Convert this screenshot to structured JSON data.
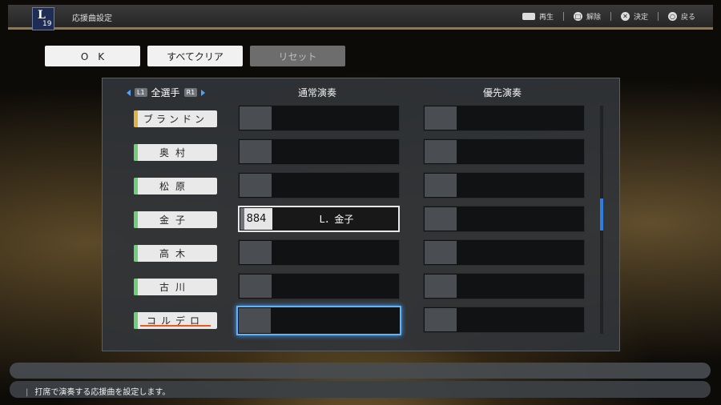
{
  "header": {
    "logo_letter": "L",
    "logo_number": "19",
    "title": "応援曲設定",
    "hints": [
      {
        "icon": "touchpad-icon",
        "label": "再生"
      },
      {
        "icon": "square-button-icon",
        "label": "解除"
      },
      {
        "icon": "cross-button-icon",
        "label": "決定"
      },
      {
        "icon": "circle-button-icon",
        "label": "戻る"
      }
    ]
  },
  "buttons": {
    "ok": "O　K",
    "clear_all": "すべてクリア",
    "reset": "リセット"
  },
  "columns": {
    "left_tag": "L1",
    "right_tag": "R1",
    "filter": "全選手",
    "normal": "通常演奏",
    "priority": "優先演奏"
  },
  "players": [
    {
      "name": "ブランドン",
      "accent": "#e0b24a"
    },
    {
      "name": "奥村",
      "accent": "#6fcf7a"
    },
    {
      "name": "松原",
      "accent": "#6fcf7a"
    },
    {
      "name": "金子",
      "accent": "#6fcf7a"
    },
    {
      "name": "高木",
      "accent": "#6fcf7a"
    },
    {
      "name": "古川",
      "accent": "#6fcf7a"
    },
    {
      "name": "コルデロ",
      "accent": "#6fcf7a"
    }
  ],
  "normal_songs": [
    "",
    "",
    "",
    {
      "number": "884",
      "title": "L．金子"
    },
    "",
    "",
    ""
  ],
  "priority_songs": [
    "",
    "",
    "",
    "",
    "",
    "",
    ""
  ],
  "help_text": "打席で演奏する応援曲を設定します。",
  "colors": {
    "selection": "#5ab4ff",
    "scroll_thumb": "#2f7de0",
    "underline": "#e85a1a"
  }
}
